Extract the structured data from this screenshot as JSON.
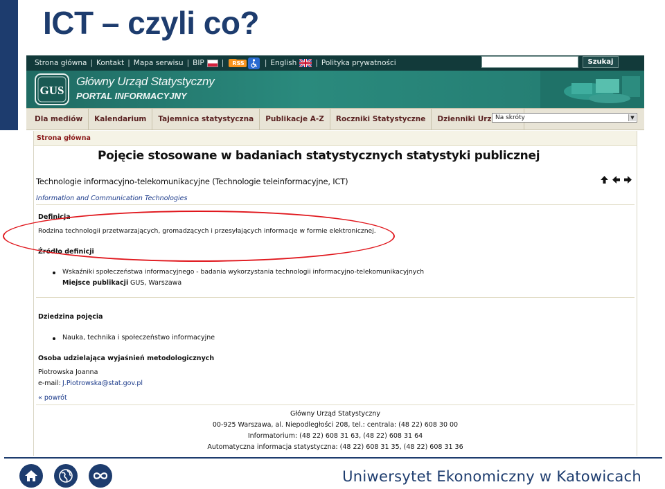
{
  "slide": {
    "title": "ICT – czyli co?",
    "university": "Uniwersytet Ekonomiczny w Katowicach"
  },
  "topbar": {
    "links": [
      "Strona główna",
      "Kontakt",
      "Mapa serwisu",
      "BIP"
    ],
    "rss_label": "RSS",
    "english_label": "English",
    "privacy_label": "Polityka prywatności",
    "search_value": "",
    "search_button": "Szukaj"
  },
  "banner": {
    "logo_text": "GUS",
    "title": "Główny Urząd Statystyczny",
    "subtitle": "PORTAL INFORMACYJNY"
  },
  "nav": {
    "items": [
      "Dla mediów",
      "Kalendarium",
      "Tajemnica statystyczna",
      "Publikacje A-Z",
      "Roczniki Statystyczne",
      "Dzienniki Urzędowe"
    ],
    "shortcut_select": "Na skróty"
  },
  "content": {
    "breadcrumb": "Strona główna",
    "heading": "Pojęcie stosowane w badaniach statystycznych statystyki publicznej",
    "term_title": "Technologie informacyjno-telekomunikacyjne (Technologie teleinformacyjne, ICT)",
    "term_en": "Information and Communication Technologies",
    "definition_label": "Definicja",
    "definition_text": "Rodzina technologii przetwarzających, gromadzących i przesyłających informacje w formie elektronicznej.",
    "source_label": "Źródło definicji",
    "source_item": "Wskaźniki społeczeństwa informacyjnego - badania wykorzystania technologii informacyjno-telekomunikacyjnych",
    "publication_label": "Miejsce publikacji",
    "publication_value": "GUS, Warszawa",
    "domain_label": "Dziedzina pojęcia",
    "domain_item": "Nauka, technika i społeczeństwo informacyjne",
    "contact_label": "Osoba udzielająca wyjaśnień metodologicznych",
    "contact_name": "Piotrowska Joanna",
    "email_label": "e-mail:",
    "email_value": "J.Piotrowska@stat.gov.pl",
    "back_link": "« powrót"
  },
  "footer": {
    "lines": [
      "Główny Urząd Statystyczny",
      "00-925 Warszawa, al. Niepodległości 208, tel.: centrala: (48 22) 608 30 00",
      "Informatorium:  (48 22) 608 31 63, (48 22) 608 31 64",
      "Automatyczna informacja statystyczna: (48 22) 608 31 35, (48 22) 608 31 36"
    ]
  },
  "colors": {
    "slide_accent": "#1d3c6e",
    "portal_green": "#237a70",
    "highlight_red": "#e0161c"
  }
}
